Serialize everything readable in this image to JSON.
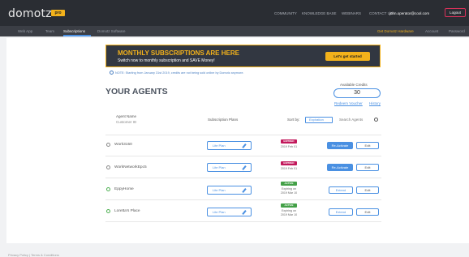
{
  "brand": {
    "logo": "domotz",
    "badge": "pro",
    "accent": "#f3b21b",
    "dark": "#2a2d33"
  },
  "topnav": {
    "items": [
      "COMMUNITY",
      "KNOWLEDGE BASE",
      "WEBINARS",
      "CONTACT US"
    ],
    "email": "john.operator@cool.com",
    "logout": "Logout"
  },
  "subnav": {
    "items": [
      "Web App",
      "Team",
      "Subscriptions",
      "Domotz Software"
    ],
    "active": "Subscriptions",
    "hardware": "Get Domotz Hardware",
    "account": "Account",
    "password": "Password"
  },
  "banner": {
    "title": "MONTHLY SUBSCRIPTIONS ARE HERE",
    "subtitle": "Switch now to monthly subscription and SAVE Money!",
    "cta": "Let's get started"
  },
  "note": "NOTE: Starting from January 31st 2019, credits are not being sold online by Domotz anymore.",
  "agents": {
    "heading": "YOUR AGENTS",
    "credits_label": "Available Credits",
    "credits_value": "30",
    "redeem": "Redeem Voucher",
    "history": "History",
    "columns": {
      "name": "Agent Name",
      "customer_id": "Customer ID",
      "plans": "Subscription Plans",
      "sort_by": "Sort by:",
      "sort_value": "Expiration",
      "search": "Search Agents"
    },
    "rows": [
      {
        "name": "Work3150",
        "plan": "Lite Plan",
        "status": "EXPIRED",
        "status_line": "",
        "date": "2019 Feb 01",
        "action": "Re-Activate",
        "edit": "Edit",
        "online": false
      },
      {
        "name": "WorkNetworkEpc5",
        "plan": "Lite Plan",
        "status": "EXPIRED",
        "status_line": "",
        "date": "2019 Feb 01",
        "action": "Re-Activate",
        "edit": "Edit",
        "online": false
      },
      {
        "name": "EppyHome",
        "plan": "Lite Plan",
        "status": "ACTIVE",
        "status_line": "Expiring on",
        "date": "2019 Mar 10",
        "action": "Extend",
        "edit": "Edit",
        "online": true
      },
      {
        "name": "Loretta's Place",
        "plan": "Lite Plan",
        "status": "ACTIVE",
        "status_line": "Expiring on",
        "date": "2019 Mar 10",
        "action": "Extend",
        "edit": "Edit",
        "online": true
      }
    ]
  },
  "footer": "Privacy Policy | Terms & Conditions"
}
